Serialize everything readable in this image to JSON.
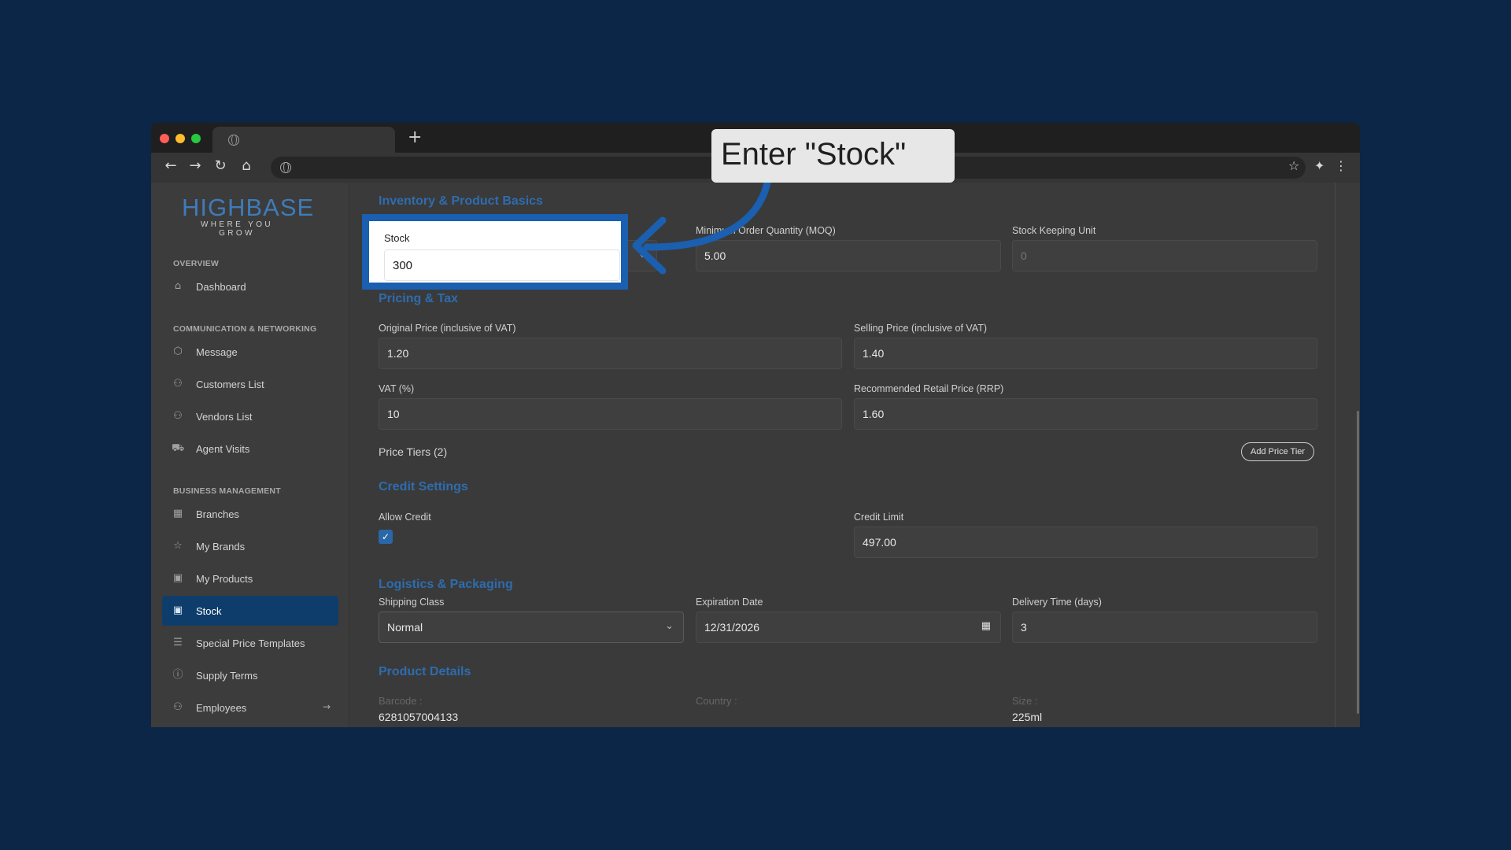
{
  "browser": {
    "nav": {
      "back": "←",
      "forward": "→",
      "reload": "↻",
      "home": "⌂"
    },
    "new_tab": "+",
    "icons": [
      "globe-icon",
      "star-icon",
      "extensions-icon",
      "menu-icon"
    ]
  },
  "sidebar": {
    "logo": {
      "main": "HIGHBASE",
      "tagline": "WHERE YOU GROW"
    },
    "sections": [
      {
        "label": "OVERVIEW"
      },
      {
        "label": "COMMUNICATION & NETWORKING"
      },
      {
        "label": "BUSINESS MANAGEMENT"
      }
    ],
    "items": [
      {
        "label": "Dashboard",
        "icon": "home-icon"
      },
      {
        "label": "Message",
        "icon": "message-icon"
      },
      {
        "label": "Customers List",
        "icon": "users-icon"
      },
      {
        "label": "Vendors List",
        "icon": "users-icon"
      },
      {
        "label": "Agent Visits",
        "icon": "truck-icon"
      },
      {
        "label": "Branches",
        "icon": "store-icon"
      },
      {
        "label": "My Brands",
        "icon": "star-icon"
      },
      {
        "label": "My Products",
        "icon": "box-icon"
      },
      {
        "label": "Stock",
        "icon": "box-icon",
        "active": true
      },
      {
        "label": "Special Price Templates",
        "icon": "list-icon"
      },
      {
        "label": "Supply Terms",
        "icon": "info-icon"
      },
      {
        "label": "Employees",
        "icon": "team-icon",
        "arrow": "→"
      }
    ]
  },
  "form": {
    "inventory": {
      "heading": "Inventory & Product Basics",
      "moq_label": "Minimum Order Quantity (MOQ)",
      "moq_value": "5.00",
      "sku_label": "Stock Keeping Unit",
      "sku_value": "0"
    },
    "pricing": {
      "heading": "Pricing & Tax",
      "original_label": "Original Price (inclusive of VAT)",
      "original_value": "1.20",
      "selling_label": "Selling Price (inclusive of VAT)",
      "selling_value": "1.40",
      "vat_label": "VAT (%)",
      "vat_value": "10",
      "rrp_label": "Recommended Retail Price (RRP)",
      "rrp_value": "1.60",
      "tiers_label": "Price Tiers (2)",
      "add_tier_button": "Add Price Tier"
    },
    "credit": {
      "heading": "Credit Settings",
      "allow_label": "Allow Credit",
      "allow_checked": true,
      "limit_label": "Credit Limit",
      "limit_value": "497.00"
    },
    "logistics": {
      "heading": "Logistics & Packaging",
      "shipping_label": "Shipping Class",
      "shipping_value": "Normal",
      "expiration_label": "Expiration Date",
      "expiration_value": "12/31/2026",
      "delivery_label": "Delivery Time (days)",
      "delivery_value": "3"
    },
    "details": {
      "heading": "Product Details",
      "barcode_label": "Barcode :",
      "barcode_value": "6281057004133",
      "country_label": "Country :",
      "size_label": "Size :",
      "size_value": "225ml"
    }
  },
  "highlight": {
    "label": "Stock",
    "value": "300"
  },
  "callout": {
    "text": "Enter \"Stock\""
  },
  "colors": {
    "background": "#0b2647",
    "accent": "#1a5fb0",
    "heading": "#2e6cae",
    "active_nav": "#0e3d6b"
  }
}
